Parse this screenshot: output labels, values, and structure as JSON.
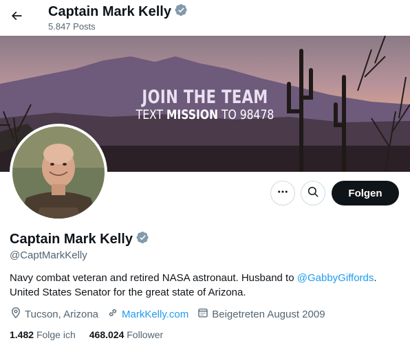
{
  "header": {
    "back_icon": "arrow-left-icon",
    "name": "Captain Mark Kelly",
    "posts": "5.847 Posts",
    "verified_icon": "verified-badge-icon"
  },
  "banner": {
    "line1": "JOIN THE TEAM",
    "line2_prefix": "TEXT ",
    "line2_bold": "MISSION",
    "line2_suffix": " TO 98478"
  },
  "actions": {
    "more_icon": "more-dots-icon",
    "search_icon": "search-icon",
    "follow_label": "Folgen"
  },
  "profile": {
    "name": "Captain Mark Kelly",
    "handle": "@CaptMarkKelly",
    "bio_part1": "Navy combat veteran and retired NASA astronaut. Husband to ",
    "bio_mention": "@GabbyGiffords",
    "bio_part2": ". United States Senator for the great state of Arizona.",
    "location": "Tucson, Arizona",
    "website": "MarkKelly.com",
    "joined": "Beigetreten August 2009"
  },
  "stats": {
    "following_count": "1.482",
    "following_label": "Folge ich",
    "followers_count": "468.024",
    "followers_label": "Follower"
  },
  "colors": {
    "accent": "#1d9bf0",
    "verified": "#829aab",
    "text": "#0f1419",
    "muted": "#536471"
  }
}
